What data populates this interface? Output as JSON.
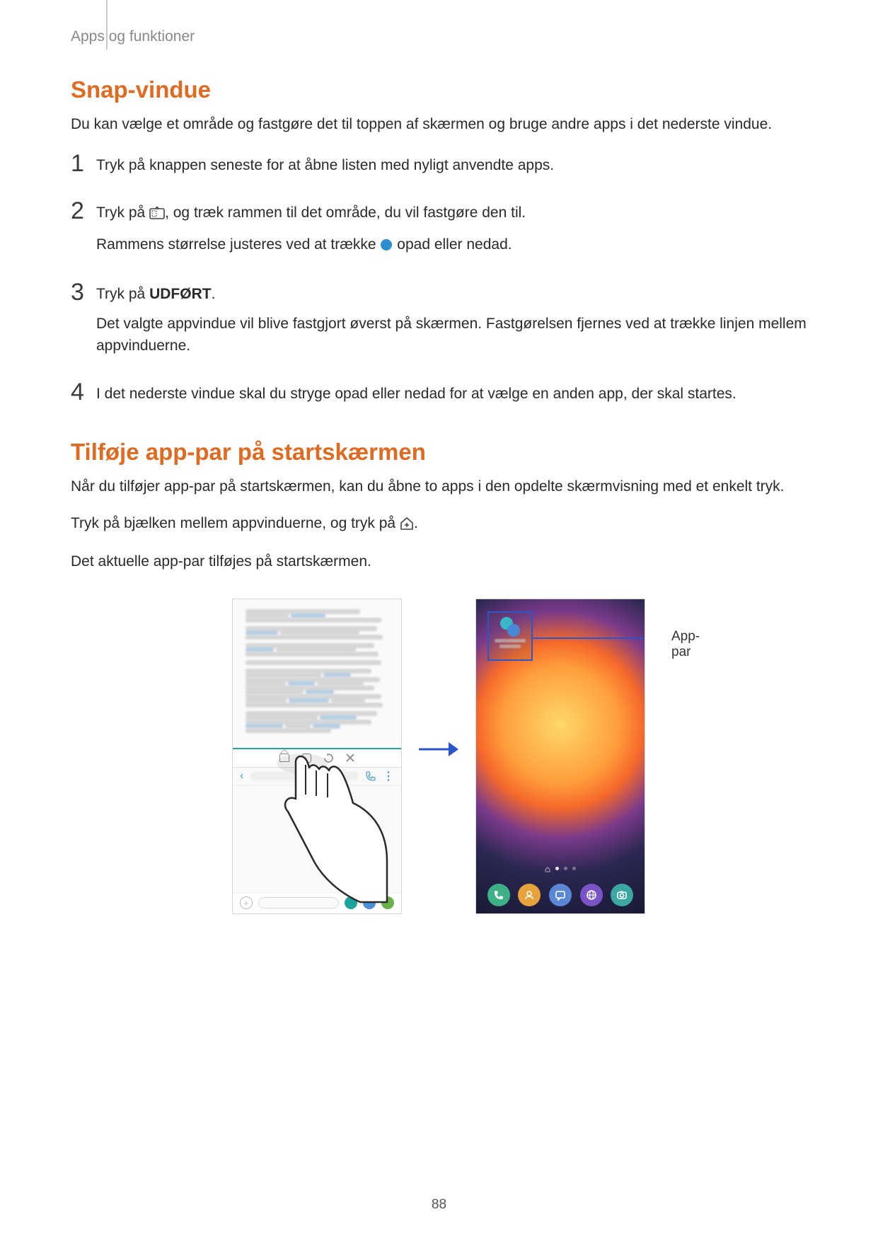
{
  "breadcrumb": "Apps og funktioner",
  "section1": {
    "title": "Snap-vindue",
    "intro": "Du kan vælge et område og fastgøre det til toppen af skærmen og bruge andre apps i det nederste vindue.",
    "steps": {
      "s1": "Tryk på knappen seneste for at åbne listen med nyligt anvendte apps.",
      "s2a": "Tryk på ",
      "s2b": ", og træk rammen til det område, du vil fastgøre den til.",
      "s2c": "Rammens størrelse justeres ved at trække ",
      "s2d": " opad eller nedad.",
      "s3a": "Tryk på ",
      "s3bold": "UDFØRT",
      "s3b": ".",
      "s3c": "Det valgte appvindue vil blive fastgjort øverst på skærmen. Fastgørelsen fjernes ved at trække linjen mellem appvinduerne.",
      "s4": "I det nederste vindue skal du stryge opad eller nedad for at vælge en anden app, der skal startes."
    }
  },
  "section2": {
    "title": "Tilføje app-par på startskærmen",
    "p1": "Når du tilføjer app-par på startskærmen, kan du åbne to apps i den opdelte skærmvisning med et enkelt tryk.",
    "p2a": "Tryk på bjælken mellem appvinduerne, og tryk på ",
    "p2b": ".",
    "p3": "Det aktuelle app-par tilføjes på startskærmen."
  },
  "callout": "App-par",
  "pageNumber": "88"
}
